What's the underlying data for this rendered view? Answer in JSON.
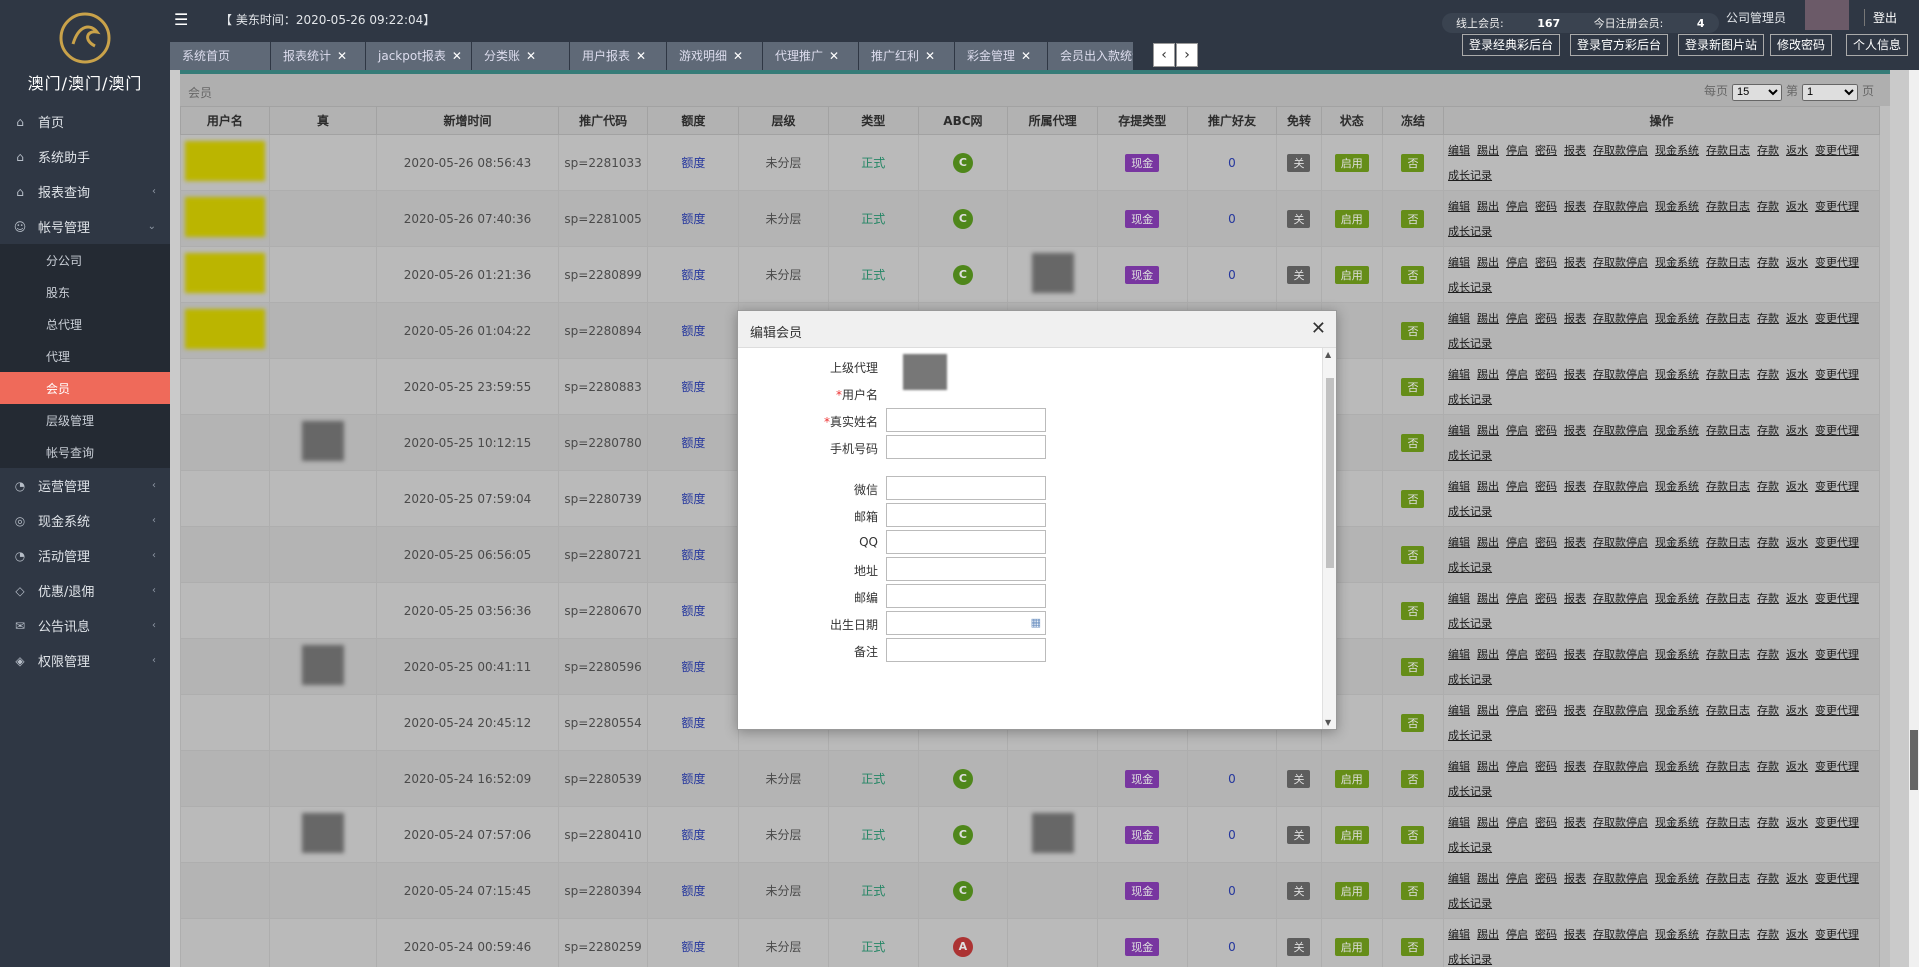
{
  "app": {
    "logo_text": "澳门/澳门/澳门",
    "time_label": "【 美东时间：2020-05-26 09:22:04】",
    "online_label": "线上会员:",
    "online_value": "167",
    "today_label": "今日注册会员:",
    "today_value": "4",
    "admin": "公司管理员",
    "logout": "登出"
  },
  "sidebar": {
    "items": [
      {
        "label": "首页",
        "icon": "home-icon",
        "glyph": "⌂"
      },
      {
        "label": "系统助手",
        "icon": "bank-icon",
        "glyph": "⌂"
      },
      {
        "label": "报表查询",
        "icon": "bank-icon",
        "glyph": "⌂"
      },
      {
        "label": "帐号管理",
        "icon": "user-icon",
        "glyph": "☺"
      }
    ],
    "sub": [
      {
        "label": "分公司"
      },
      {
        "label": "股东"
      },
      {
        "label": "总代理"
      },
      {
        "label": "代理"
      },
      {
        "label": "会员"
      },
      {
        "label": "层级管理"
      },
      {
        "label": "帐号查询"
      }
    ],
    "items2": [
      {
        "label": "运营管理",
        "glyph": "◔"
      },
      {
        "label": "现金系统",
        "glyph": "◎"
      },
      {
        "label": "活动管理",
        "glyph": "◔"
      },
      {
        "label": "优惠/退佣",
        "glyph": "◇"
      },
      {
        "label": "公告讯息",
        "glyph": "✉"
      },
      {
        "label": "权限管理",
        "glyph": "◈"
      }
    ]
  },
  "tabs": [
    "系统首页",
    "报表统计",
    "jackpot报表",
    "分类账",
    "用户报表",
    "游戏明细",
    "代理推广",
    "推广红利",
    "彩金管理",
    "会员出入款统计"
  ],
  "toolbar": [
    "登录经典彩后台",
    "登录官方彩后台",
    "登录新图片站",
    "修改密码",
    "个人信息"
  ],
  "panel": {
    "title": "会员",
    "per_page": "每页",
    "page": "第",
    "page_suffix": "页",
    "per_value": "15",
    "page_value": "1"
  },
  "table": {
    "headers": [
      "用户名",
      "真",
      "新增时间",
      "推广代码",
      "额度",
      "层级",
      "类型",
      "ABC网",
      "所属代理",
      "存提类型",
      "推广好友",
      "免转",
      "状态",
      "冻结",
      "操作"
    ],
    "rows": [
      {
        "time": "2020-05-26 08:56:43",
        "code": "sp=2281033",
        "limit": "额度",
        "level": "未分层",
        "type": "正式",
        "abc": "C",
        "cash": "现金",
        "friends": "0",
        "free": "关",
        "status": "启用",
        "frozen": "否"
      },
      {
        "time": "2020-05-26 07:40:36",
        "code": "sp=2281005",
        "limit": "额度",
        "level": "未分层",
        "type": "正式",
        "abc": "C",
        "cash": "现金",
        "friends": "0",
        "free": "关",
        "status": "启用",
        "frozen": "否"
      },
      {
        "time": "2020-05-26 01:21:36",
        "code": "sp=2280899",
        "limit": "额度",
        "level": "未分层",
        "type": "正式",
        "abc": "C",
        "cash": "现金",
        "friends": "0",
        "free": "关",
        "status": "启用",
        "frozen": "否"
      },
      {
        "time": "2020-05-26 01:04:22",
        "code": "sp=2280894",
        "limit": "额度",
        "level": "",
        "type": "",
        "abc": "",
        "cash": "",
        "friends": "",
        "free": "",
        "status": "",
        "frozen": "否"
      },
      {
        "time": "2020-05-25 23:59:55",
        "code": "sp=2280883",
        "limit": "额度",
        "level": "",
        "type": "",
        "abc": "",
        "cash": "",
        "friends": "",
        "free": "",
        "status": "",
        "frozen": "否"
      },
      {
        "time": "2020-05-25 10:12:15",
        "code": "sp=2280780",
        "limit": "额度",
        "level": "",
        "type": "",
        "abc": "",
        "cash": "",
        "friends": "",
        "free": "",
        "status": "",
        "frozen": "否"
      },
      {
        "time": "2020-05-25 07:59:04",
        "code": "sp=2280739",
        "limit": "额度",
        "level": "",
        "type": "",
        "abc": "",
        "cash": "",
        "friends": "",
        "free": "",
        "status": "",
        "frozen": "否"
      },
      {
        "time": "2020-05-25 06:56:05",
        "code": "sp=2280721",
        "limit": "额度",
        "level": "",
        "type": "",
        "abc": "",
        "cash": "",
        "friends": "",
        "free": "",
        "status": "",
        "frozen": "否"
      },
      {
        "time": "2020-05-25 03:56:36",
        "code": "sp=2280670",
        "limit": "额度",
        "level": "",
        "type": "",
        "abc": "",
        "cash": "",
        "friends": "",
        "free": "",
        "status": "",
        "frozen": "否"
      },
      {
        "time": "2020-05-25 00:41:11",
        "code": "sp=2280596",
        "limit": "额度",
        "level": "",
        "type": "",
        "abc": "",
        "cash": "",
        "friends": "",
        "free": "",
        "status": "",
        "frozen": "否"
      },
      {
        "time": "2020-05-24 20:45:12",
        "code": "sp=2280554",
        "limit": "额度",
        "level": "",
        "type": "",
        "abc": "",
        "cash": "",
        "friends": "",
        "free": "",
        "status": "",
        "frozen": "否"
      },
      {
        "time": "2020-05-24 16:52:09",
        "code": "sp=2280539",
        "limit": "额度",
        "level": "未分层",
        "type": "正式",
        "abc": "C",
        "cash": "现金",
        "friends": "0",
        "free": "关",
        "status": "启用",
        "frozen": "否"
      },
      {
        "time": "2020-05-24 07:57:06",
        "code": "sp=2280410",
        "limit": "额度",
        "level": "未分层",
        "type": "正式",
        "abc": "C",
        "cash": "现金",
        "friends": "0",
        "free": "关",
        "status": "启用",
        "frozen": "否"
      },
      {
        "time": "2020-05-24 07:15:45",
        "code": "sp=2280394",
        "limit": "额度",
        "level": "未分层",
        "type": "正式",
        "abc": "C",
        "cash": "现金",
        "friends": "0",
        "free": "关",
        "status": "启用",
        "frozen": "否"
      },
      {
        "time": "2020-05-24 00:59:46",
        "code": "sp=2280259",
        "limit": "额度",
        "level": "未分层",
        "type": "正式",
        "abc": "A",
        "cash": "现金",
        "friends": "0",
        "free": "关",
        "status": "启用",
        "frozen": "否"
      }
    ],
    "ops": [
      "编辑",
      "踢出",
      "停启",
      "密码",
      "报表",
      "存取款停启",
      "现金系统",
      "存款日志",
      "存款",
      "返水",
      "变更代理",
      "成长记录"
    ]
  },
  "modal": {
    "title": "编辑会员",
    "fields": [
      {
        "label": "上级代理",
        "req": false,
        "input": false
      },
      {
        "label": "用户名",
        "req": true,
        "input": false
      },
      {
        "label": "真实姓名",
        "req": true,
        "input": true
      },
      {
        "label": "手机号码",
        "req": false,
        "input": true
      },
      {
        "label": "微信",
        "req": false,
        "input": true
      },
      {
        "label": "邮箱",
        "req": false,
        "input": true
      },
      {
        "label": "QQ",
        "req": false,
        "input": true
      },
      {
        "label": "地址",
        "req": false,
        "input": true
      },
      {
        "label": "邮编",
        "req": false,
        "input": true
      },
      {
        "label": "出生日期",
        "req": false,
        "input": true
      },
      {
        "label": "备注",
        "req": false,
        "input": true
      }
    ]
  }
}
